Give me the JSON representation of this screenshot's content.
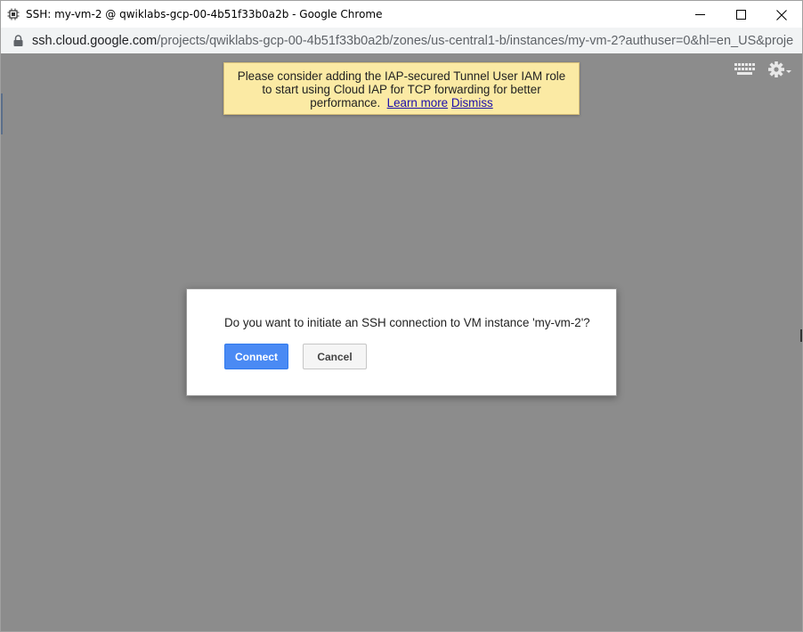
{
  "window": {
    "title": "SSH: my-vm-2 @ qwiklabs-gcp-00-4b51f33b0a2b - Google Chrome"
  },
  "address_bar": {
    "host": "ssh.cloud.google.com",
    "path": "/projects/qwiklabs-gcp-00-4b51f33b0a2b/zones/us-central1-b/instances/my-vm-2?authuser=0&hl=en_US&proje..."
  },
  "banner": {
    "line1": "Please consider adding the IAP-secured Tunnel User IAM role",
    "line2": "to start using Cloud IAP for TCP forwarding for better",
    "line3": "performance.",
    "learn_more": "Learn more",
    "dismiss": "Dismiss"
  },
  "dialog": {
    "message": "Do you want to initiate an SSH connection to VM instance 'my-vm-2'?",
    "connect_label": "Connect",
    "cancel_label": "Cancel"
  },
  "colors": {
    "overlay": "#8c8c8c",
    "banner_bg": "#fbeaa4",
    "connect_bg": "#4a8af4"
  },
  "icons": [
    "app-icon",
    "minimize-icon",
    "maximize-icon",
    "close-icon",
    "lock-icon",
    "keyboard-icon",
    "gear-icon"
  ]
}
